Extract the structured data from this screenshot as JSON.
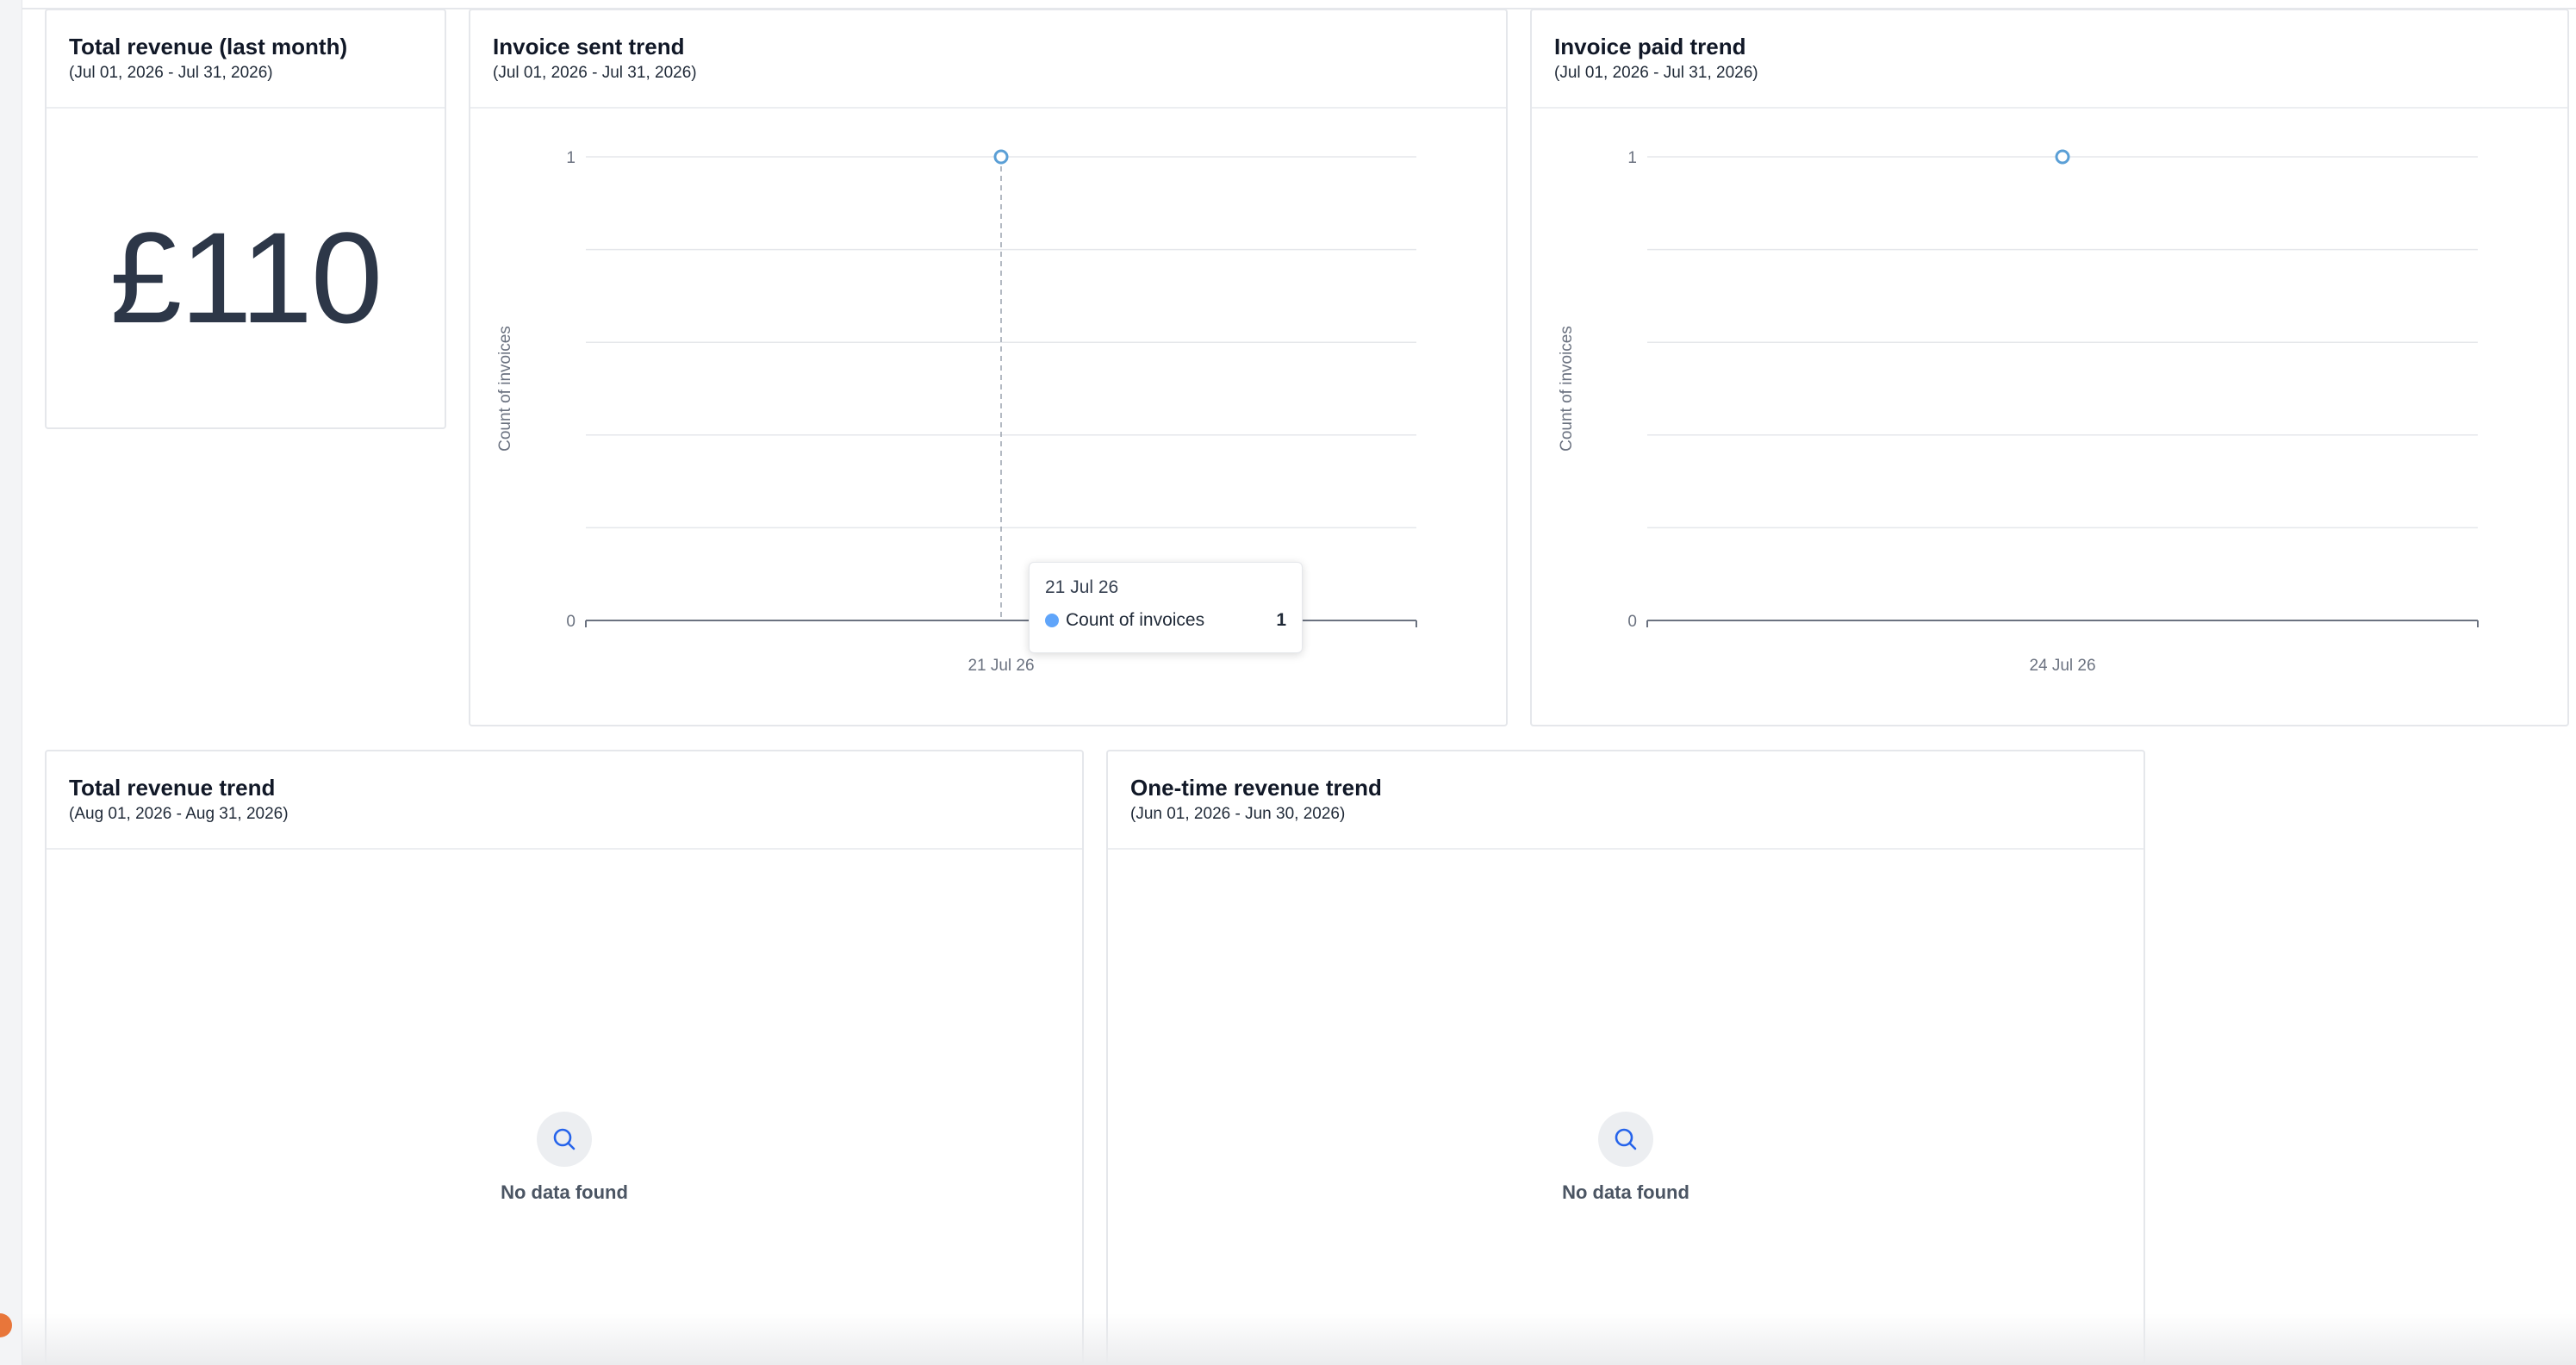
{
  "cards": {
    "total_revenue": {
      "title": "Total revenue (last month)",
      "subtitle": "(Jul 01, 2026 - Jul 31, 2026)",
      "value": "£110"
    },
    "invoice_sent_trend": {
      "title": "Invoice sent trend",
      "subtitle": "(Jul 01, 2026 - Jul 31, 2026)",
      "tooltip": {
        "date": "21 Jul 26",
        "series": "Count of invoices",
        "value": "1"
      }
    },
    "invoice_paid_trend": {
      "title": "Invoice paid trend",
      "subtitle": "(Jul 01, 2026 - Jul 31, 2026)"
    },
    "total_revenue_trend": {
      "title": "Total revenue trend",
      "subtitle": "(Aug 01, 2026 - Aug 31, 2026)",
      "empty_text": "No data found",
      "empty_icon": "search-icon"
    },
    "one_time_revenue_trend": {
      "title": "One-time revenue trend",
      "subtitle": "(Jun 01, 2026 - Jun 30, 2026)",
      "empty_text": "No data found",
      "empty_icon": "search-icon"
    }
  },
  "colors": {
    "line": "#5a9fd6",
    "grid": "#e5e7eb",
    "axis": "#6b7280",
    "text_muted": "#6b7280",
    "accent_orange": "#e8763a"
  },
  "chart_data": [
    {
      "type": "line",
      "x": [
        "21 Jul 26"
      ],
      "series": [
        {
          "name": "Count of invoices",
          "values": [
            1
          ]
        }
      ],
      "title": "Invoice sent trend",
      "xlabel": "",
      "ylabel": "Count of invoices",
      "ylim": [
        0,
        1
      ],
      "yticks": [
        "0",
        "1"
      ],
      "grid": true
    },
    {
      "type": "line",
      "x": [
        "24 Jul 26"
      ],
      "series": [
        {
          "values": [
            1
          ]
        }
      ],
      "title": "Invoice paid trend",
      "xlabel": "",
      "ylabel": "Count of invoices",
      "ylim": [
        0,
        1
      ],
      "yticks": [
        "0",
        "1"
      ],
      "grid": true
    }
  ]
}
